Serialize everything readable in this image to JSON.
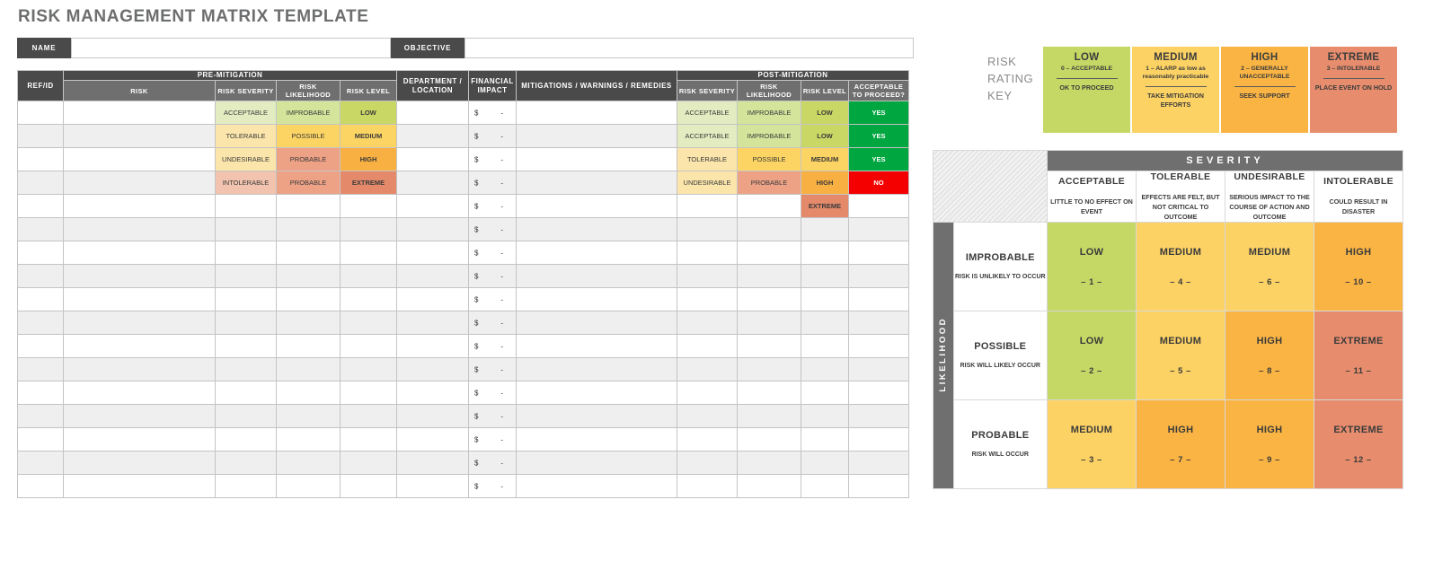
{
  "title": "RISK MANAGEMENT MATRIX TEMPLATE",
  "infobar": {
    "name_label": "NAME",
    "name_value": "",
    "objective_label": "OBJECTIVE",
    "objective_value": ""
  },
  "table": {
    "group_headers": {
      "ref_id": "REF/ID",
      "pre_mitigation": "PRE-MITIGATION",
      "department_location": "DEPARTMENT / LOCATION",
      "financial_impact": "FINANCIAL IMPACT",
      "mitigations": "MITIGATIONS / WARNINGS / REMEDIES",
      "post_mitigation": "POST-MITIGATION"
    },
    "sub_headers": {
      "risk": "RISK",
      "risk_severity": "RISK SEVERITY",
      "risk_likelihood": "RISK LIKELIHOOD",
      "risk_level": "RISK LEVEL",
      "post_risk_severity": "RISK SEVERITY",
      "post_risk_likelihood": "RISK LIKELIHOOD",
      "post_risk_level": "RISK LEVEL",
      "acceptable_to_proceed": "ACCEPTABLE TO PROCEED?"
    },
    "currency_symbol": "$",
    "currency_value": "-",
    "row_count": 17,
    "rows": [
      {
        "pre_severity": "ACCEPTABLE",
        "pre_likelihood": "IMPROBABLE",
        "pre_level": "LOW",
        "post_severity": "ACCEPTABLE",
        "post_likelihood": "IMPROBABLE",
        "post_level": "LOW",
        "accept": "YES"
      },
      {
        "pre_severity": "TOLERABLE",
        "pre_likelihood": "POSSIBLE",
        "pre_level": "MEDIUM",
        "post_severity": "ACCEPTABLE",
        "post_likelihood": "IMPROBABLE",
        "post_level": "LOW",
        "accept": "YES"
      },
      {
        "pre_severity": "UNDESIRABLE",
        "pre_likelihood": "PROBABLE",
        "pre_level": "HIGH",
        "post_severity": "TOLERABLE",
        "post_likelihood": "POSSIBLE",
        "post_level": "MEDIUM",
        "accept": "YES"
      },
      {
        "pre_severity": "INTOLERABLE",
        "pre_likelihood": "PROBABLE",
        "pre_level": "EXTREME",
        "post_severity": "UNDESIRABLE",
        "post_likelihood": "PROBABLE",
        "post_level": "HIGH",
        "accept": "NO"
      },
      {
        "pre_severity": "",
        "pre_likelihood": "",
        "pre_level": "",
        "post_severity": "",
        "post_likelihood": "",
        "post_level": "EXTREME",
        "accept": ""
      }
    ]
  },
  "risk_rating_key": {
    "label": "RISK RATING KEY",
    "cards": [
      {
        "title": "LOW",
        "sub": "0 – ACCEPTABLE",
        "action": "OK TO PROCEED",
        "color": "#c5d765"
      },
      {
        "title": "MEDIUM",
        "sub": "1 – ALARP as low as reasonably practicable",
        "action": "TAKE MITIGATION EFFORTS",
        "color": "#fcd264"
      },
      {
        "title": "HIGH",
        "sub": "2 – GENERALLY UNACCEPTABLE",
        "action": "SEEK SUPPORT",
        "color": "#f9b444"
      },
      {
        "title": "EXTREME",
        "sub": "3 – INTOLERABLE",
        "action": "PLACE EVENT ON HOLD",
        "color": "#e78d6e"
      }
    ]
  },
  "chart_data": {
    "type": "heatmap",
    "title": "SEVERITY",
    "xlabel": "SEVERITY",
    "ylabel": "LIKELIHOOD",
    "categories_x": [
      "ACCEPTABLE",
      "TOLERABLE",
      "UNDESIRABLE",
      "INTOLERABLE"
    ],
    "x_descriptions": [
      "LITTLE TO NO EFFECT ON EVENT",
      "EFFECTS ARE FELT, BUT NOT CRITICAL TO OUTCOME",
      "SERIOUS IMPACT TO THE COURSE OF ACTION AND OUTCOME",
      "COULD RESULT IN DISASTER"
    ],
    "categories_y": [
      "IMPROBABLE",
      "POSSIBLE",
      "PROBABLE"
    ],
    "y_descriptions": [
      "RISK IS UNLIKELY TO OCCUR",
      "RISK WILL LIKELY OCCUR",
      "RISK WILL OCCUR"
    ],
    "cells": [
      [
        {
          "label": "LOW",
          "value": "– 1 –",
          "level": "low"
        },
        {
          "label": "MEDIUM",
          "value": "– 4 –",
          "level": "med"
        },
        {
          "label": "MEDIUM",
          "value": "– 6 –",
          "level": "med"
        },
        {
          "label": "HIGH",
          "value": "– 10 –",
          "level": "high"
        }
      ],
      [
        {
          "label": "LOW",
          "value": "– 2 –",
          "level": "low"
        },
        {
          "label": "MEDIUM",
          "value": "– 5 –",
          "level": "med"
        },
        {
          "label": "HIGH",
          "value": "– 8 –",
          "level": "high"
        },
        {
          "label": "EXTREME",
          "value": "– 11 –",
          "level": "ext"
        }
      ],
      [
        {
          "label": "MEDIUM",
          "value": "– 3 –",
          "level": "med"
        },
        {
          "label": "HIGH",
          "value": "– 7 –",
          "level": "high"
        },
        {
          "label": "HIGH",
          "value": "– 9 –",
          "level": "high"
        },
        {
          "label": "EXTREME",
          "value": "– 12 –",
          "level": "ext"
        }
      ]
    ],
    "colors": {
      "low": "#c5d765",
      "med": "#fcd264",
      "high": "#f9b444",
      "ext": "#e78d6e"
    },
    "grid": true,
    "legend": "none"
  }
}
